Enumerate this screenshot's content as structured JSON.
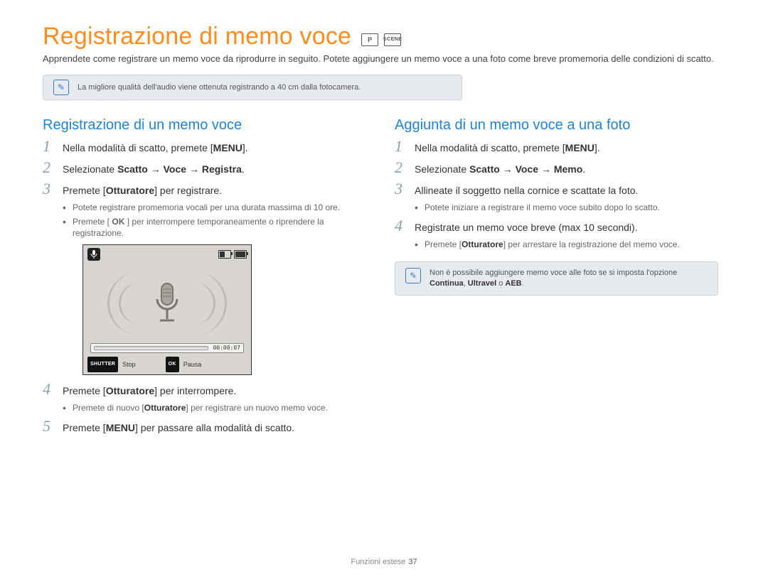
{
  "title": "Registrazione di memo voce",
  "title_mode_icons": {
    "camera": "P",
    "scene": "SCENE"
  },
  "intro": "Apprendete come registrare un memo voce da riprodurre in seguito. Potete aggiungere un memo voce a una foto come breve promemoria delle condizioni di scatto.",
  "tip_top": "La migliore qualità dell'audio viene ottenuta registrando a 40 cm dalla fotocamera.",
  "left": {
    "heading": "Registrazione di un memo voce",
    "step1_a": "Nella modalità di scatto, premete [",
    "step1_key": "MENU",
    "step1_b": "].",
    "step2_a": "Selezionate ",
    "step2_b": "Scatto → Voce → Registra",
    "step2_c": ".",
    "step3_a": "Premete [",
    "step3_key": "Otturatore",
    "step3_b": "] per registrare.",
    "step3_sub1": "Potete registrare promemoria vocali per una durata massima di 10 ore.",
    "step3_sub2a": "Premete [ ",
    "step3_sub2key": "OK",
    "step3_sub2b": " ] per interrompere temporaneamente o riprendere la registrazione.",
    "step4_a": "Premete [",
    "step4_key": "Otturatore",
    "step4_b": "] per interrompere.",
    "step4_sub_a": "Premete di nuovo [",
    "step4_sub_key": "Otturatore",
    "step4_sub_b": "] per registrare un nuovo memo voce.",
    "step5_a": "Premete [",
    "step5_key": "MENU",
    "step5_b": "] per passare alla modalità di scatto."
  },
  "camera": {
    "time": "00:00:07",
    "shutter_chip": "SHUTTER",
    "shutter_label": "Stop",
    "ok_chip": "OK",
    "ok_label": "Pausa"
  },
  "right": {
    "heading": "Aggiunta di un memo voce a una foto",
    "step1_a": "Nella modalità di scatto, premete [",
    "step1_key": "MENU",
    "step1_b": "].",
    "step2_a": "Selezionate ",
    "step2_b": "Scatto → Voce → Memo",
    "step2_c": ".",
    "step3": "Allineate il soggetto nella cornice e scattate la foto.",
    "step3_sub": "Potete iniziare a registrare il memo voce subito dopo lo scatto.",
    "step4": "Registrate un memo voce breve (max 10 secondi).",
    "step4_sub_a": "Premete [",
    "step4_sub_key": "Otturatore",
    "step4_sub_b": "] per arrestare la registrazione del memo voce.",
    "tip_a": "Non è possibile aggiungere memo voce alle foto se si imposta l'opzione ",
    "tip_b": "Continua",
    "tip_c": ", ",
    "tip_d": "Ultravel",
    "tip_e": " o ",
    "tip_f": "AEB",
    "tip_g": "."
  },
  "footer_label": "Funzioni estese",
  "footer_page": "37"
}
